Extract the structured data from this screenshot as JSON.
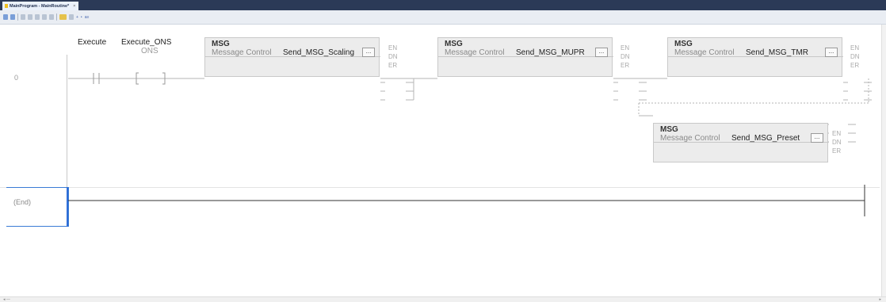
{
  "tab": {
    "title": "MainProgram - MainRoutine*",
    "close": "×"
  },
  "toolbar": {
    "text_a": "+",
    "text_b": "•",
    "text_c": "a≡"
  },
  "rungs": {
    "rung0": "0",
    "end": "(End)"
  },
  "contacts": {
    "xic_tag": "Execute",
    "ons_tag": "Execute_ONS",
    "ons_label": "ONS"
  },
  "msg_blocks": [
    {
      "title": "MSG",
      "control_label": "Message Control",
      "tag": "Send_MSG_Scaling",
      "browse": "...",
      "en": "EN",
      "dn": "DN",
      "er": "ER"
    },
    {
      "title": "MSG",
      "control_label": "Message Control",
      "tag": "Send_MSG_MUPR",
      "browse": "...",
      "en": "EN",
      "dn": "DN",
      "er": "ER"
    },
    {
      "title": "MSG",
      "control_label": "Message Control",
      "tag": "Send_MSG_TMR",
      "browse": "...",
      "en": "EN",
      "dn": "DN",
      "er": "ER"
    },
    {
      "title": "MSG",
      "control_label": "Message Control",
      "tag": "Send_MSG_Preset",
      "browse": "...",
      "en": "EN",
      "dn": "DN",
      "er": "ER"
    }
  ],
  "scrollbar": {
    "left_arrow": "◂ —",
    "right_arrow": "▸"
  },
  "colors": {
    "titlebar": "#2b3a57",
    "selection": "#2f6ed8",
    "block_fill": "#ececec"
  }
}
